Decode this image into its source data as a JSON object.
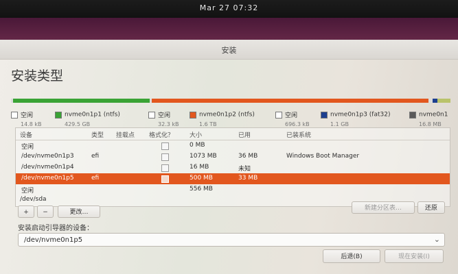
{
  "topbar": {
    "clock": "Mar 27  07:32"
  },
  "window": {
    "title": "安装"
  },
  "page": {
    "title": "安装类型"
  },
  "partition_bar": {
    "segments": [
      {
        "name": "free",
        "color": "#dcdcdc",
        "fraction": 0.005
      },
      {
        "name": "nvme0n1p1 (ntfs)",
        "color": "#3aa335",
        "fraction": 0.31
      },
      {
        "name": "free",
        "color": "#dcdcdc",
        "fraction": 0.005
      },
      {
        "name": "nvme0n1p2 (ntfs)",
        "color": "#e2571e",
        "fraction": 0.63
      },
      {
        "name": "free",
        "color": "#dcdcdc",
        "fraction": 0.01
      },
      {
        "name": "nvme0n1p3 (fat32)",
        "color": "#1d3f8f",
        "fraction": 0.01
      },
      {
        "name": "nvme0n1",
        "color": "#b9c36a",
        "fraction": 0.03
      }
    ]
  },
  "legend": [
    {
      "name": "空闲",
      "size": "14.8 kB",
      "color": "#ffffff"
    },
    {
      "name": "nvme0n1p1 (ntfs)",
      "size": "429.5 GB",
      "color": "#3aa335"
    },
    {
      "name": "空闲",
      "size": "32.3 kB",
      "color": "#ffffff"
    },
    {
      "name": "nvme0n1p2 (ntfs)",
      "size": "1.6 TB",
      "color": "#e2571e"
    },
    {
      "name": "空闲",
      "size": "696.3 kB",
      "color": "#ffffff"
    },
    {
      "name": "nvme0n1p3 (fat32)",
      "size": "1.1 GB",
      "color": "#1d3f8f"
    },
    {
      "name": "nvme0n1",
      "size": "16.8 MB",
      "color": "#5a5a5a"
    }
  ],
  "table": {
    "headers": {
      "device": "设备",
      "type": "类型",
      "mount": "挂载点",
      "format": "格式化？",
      "size": "大小",
      "used": "已用",
      "system": "已装系统"
    },
    "rows": [
      {
        "device": "空闲",
        "type": "",
        "size": "0 MB",
        "used": "",
        "system": "",
        "check": true
      },
      {
        "device": "/dev/nvme0n1p3",
        "type": "efi",
        "size": "1073 MB",
        "used": "36 MB",
        "system": "Windows Boot Manager",
        "check": true
      },
      {
        "device": "/dev/nvme0n1p4",
        "type": "",
        "size": "16 MB",
        "used": "未知",
        "system": "",
        "check": true
      },
      {
        "device": "/dev/nvme0n1p5",
        "type": "efi",
        "size": "500 MB",
        "used": "33 MB",
        "system": "",
        "check": true,
        "selected": true
      },
      {
        "device": "空闲",
        "type": "",
        "size": "556 MB",
        "used": "",
        "system": "",
        "check": false
      },
      {
        "device": "/dev/sda",
        "type": "",
        "size": "",
        "used": "",
        "system": "",
        "check": false
      }
    ]
  },
  "controls": {
    "add": "+",
    "remove": "−",
    "change": "更改…",
    "new_table": "新建分区表…",
    "revert": "还原"
  },
  "bootloader": {
    "label": "安装启动引导器的设备：",
    "value": "/dev/nvme0n1p5"
  },
  "footer": {
    "back": "后退(B)",
    "install": "现在安装(I)"
  }
}
